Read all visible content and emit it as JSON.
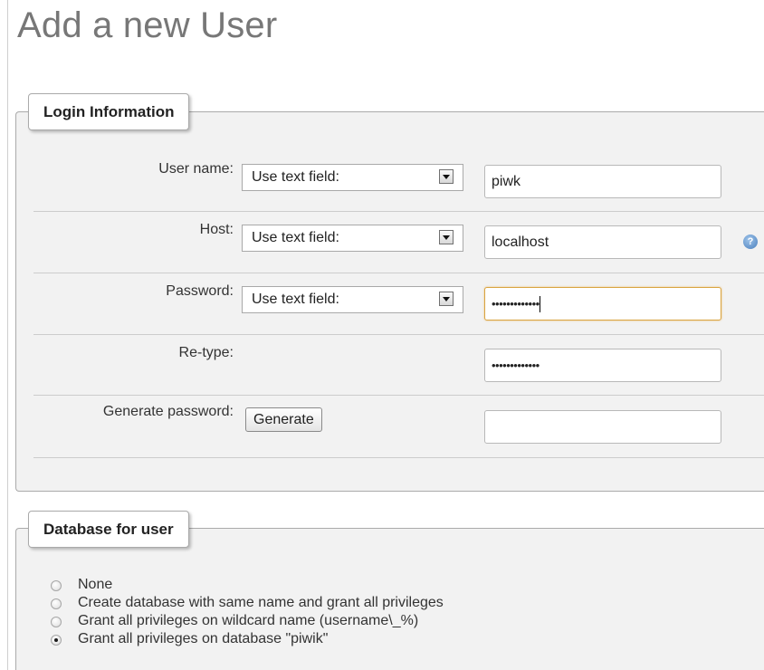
{
  "page": {
    "title": "Add a new User"
  },
  "login": {
    "legend": "Login Information",
    "username": {
      "label": "User name:",
      "select": "Use text field:",
      "value": "piwk"
    },
    "host": {
      "label": "Host:",
      "select": "Use text field:",
      "value": "localhost",
      "help_icon": "help-icon"
    },
    "password": {
      "label": "Password:",
      "select": "Use text field:",
      "value": "•••••••••••••"
    },
    "retype": {
      "label": "Re-type:",
      "value": "•••••••••••••"
    },
    "generate": {
      "label": "Generate password:",
      "button": "Generate",
      "value": ""
    }
  },
  "database": {
    "legend": "Database for user",
    "options": [
      {
        "label": "None",
        "checked": false
      },
      {
        "label": "Create database with same name and grant all privileges",
        "checked": false
      },
      {
        "label": "Grant all privileges on wildcard name (username\\_%)",
        "checked": false
      },
      {
        "label": "Grant all privileges on database \"piwik\"",
        "checked": true
      }
    ]
  },
  "colors": {
    "fieldset_bg": "#f2f2f2",
    "focus_border": "#d9a440",
    "title_gray": "#777777"
  }
}
